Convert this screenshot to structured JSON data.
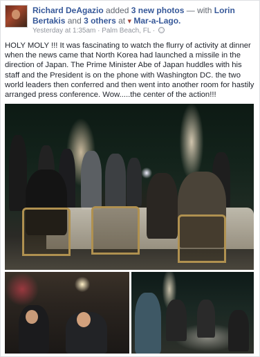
{
  "post": {
    "author": "Richard DeAgazio",
    "action": "added",
    "photos_link": "3 new photos",
    "with_text": "— with",
    "tagged_person": "Lorin Bertakis",
    "and_text": "and",
    "others_link": "3 others",
    "at_text": "at",
    "place": "Mar-a-Lago.",
    "timestamp": "Yesterday at 1:35am · Palm Beach, FL ·",
    "text": "HOLY MOLY !!! It was fascinating to watch the flurry of activity at dinner when the news came that North Korea had launched a missile in the direction of Japan. The Prime Minister Abe of Japan huddles with his staff and the President is on the phone with Washington DC. the two world leaders then conferred and then went into another room for hastily arranged press conference. Wow.....the center of the action!!!"
  },
  "icons": {
    "location": "map-pin-icon",
    "privacy": "globe-icon"
  },
  "colors": {
    "link": "#365899",
    "text": "#1d2129",
    "meta": "#90949c"
  }
}
